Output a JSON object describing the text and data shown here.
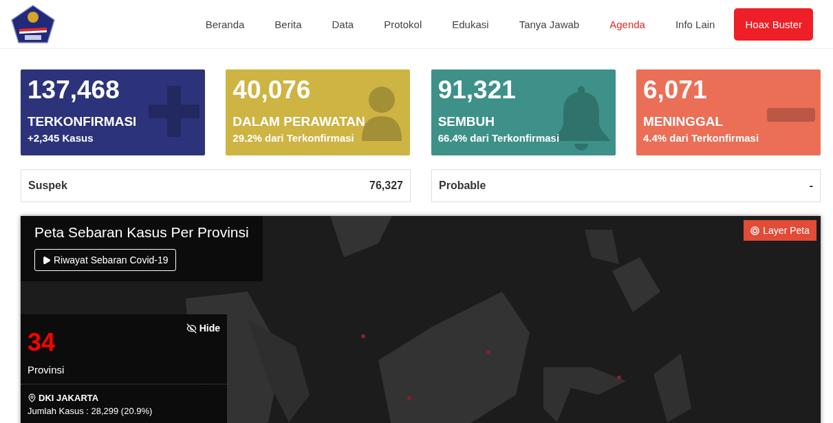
{
  "header": {
    "nav": [
      {
        "label": "Beranda",
        "selected": false
      },
      {
        "label": "Berita",
        "selected": false
      },
      {
        "label": "Data",
        "selected": false
      },
      {
        "label": "Protokol",
        "selected": false
      },
      {
        "label": "Edukasi",
        "selected": false
      },
      {
        "label": "Tanya Jawab",
        "selected": false
      },
      {
        "label": "Agenda",
        "selected": true
      },
      {
        "label": "Info Lain",
        "selected": false
      }
    ],
    "cta": "Hoax Buster"
  },
  "stats": [
    {
      "kind": "plus",
      "color": "#2c337a",
      "value": "137,468",
      "label": "TERKONFIRMASI",
      "sub": "+2,345 Kasus"
    },
    {
      "kind": "doctor",
      "color": "#cdb443",
      "value": "40,076",
      "label": "DALAM PERAWATAN",
      "sub": "29.2% dari Terkonfirmasi"
    },
    {
      "kind": "bell",
      "color": "#3d9189",
      "value": "91,321",
      "label": "SEMBUH",
      "sub": "66.4% dari Terkonfirmasi"
    },
    {
      "kind": "minus",
      "color": "#eb6e56",
      "value": "6,071",
      "label": "MENINGGAL",
      "sub": "4.4% dari Terkonfirmasi"
    }
  ],
  "extra": [
    {
      "label": "Suspek",
      "value": "76,327"
    },
    {
      "label": "Probable",
      "value": "-"
    }
  ],
  "map": {
    "title": "Peta Sebaran Kasus Per Provinsi",
    "history_button": "Riwayat Sebaran Covid-19",
    "layer_button": "Layer Peta",
    "hide": "Hide",
    "count": "34",
    "count_label": "Provinsi",
    "region": "DKI JAKARTA",
    "cases": "Jumlah Kasus : 28,299 (20.9%)"
  }
}
